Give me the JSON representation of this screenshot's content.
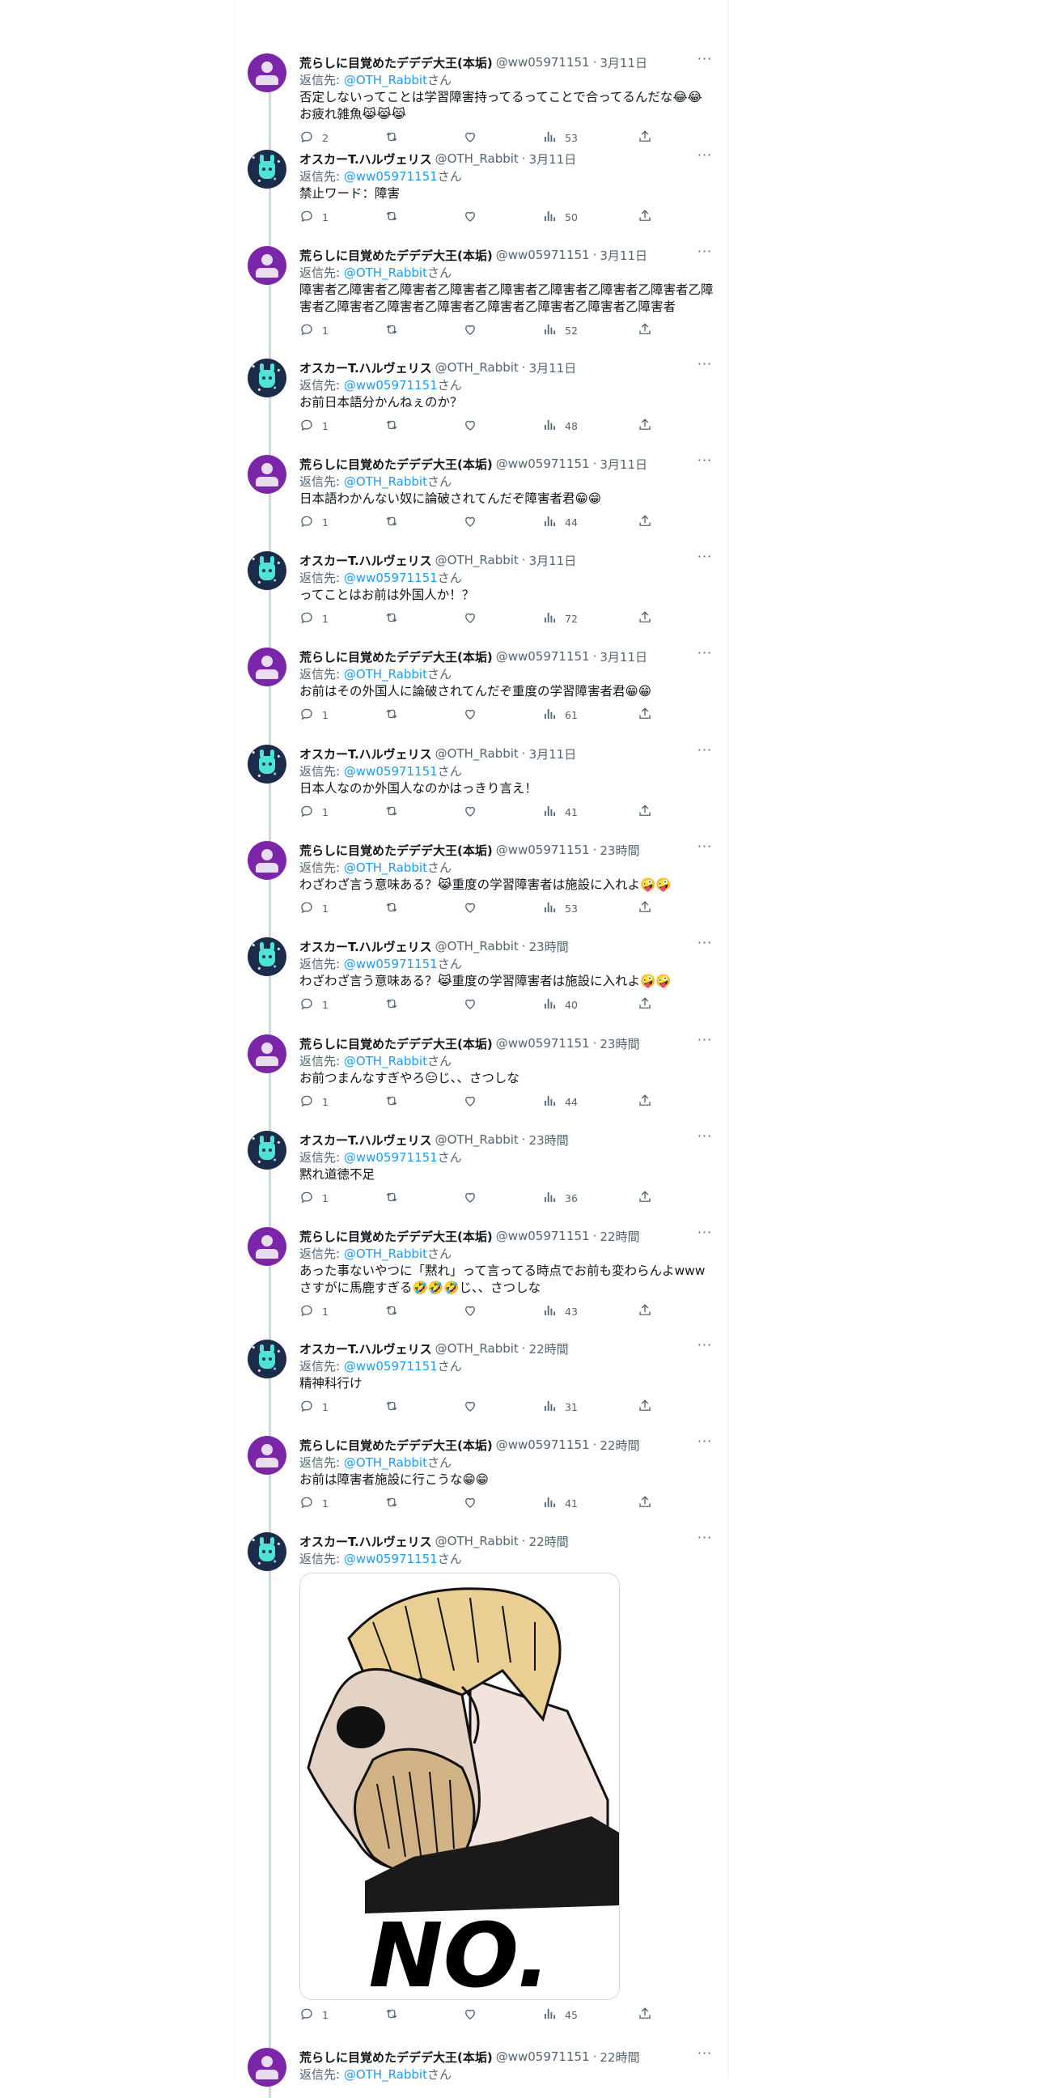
{
  "colors": {
    "link": "#1d9bf0",
    "muted": "#536471",
    "text": "#0f1419"
  },
  "tweets": [
    {
      "author": "荒らしに目覚めたデデデ大王(本垢)",
      "handle": "@ww05971151",
      "time": "3月11日",
      "reply_prefix": "返信先: ",
      "reply_to": "@OTH_Rabbit",
      "reply_suffix": "さん",
      "text": "否定しないってことは学習障害持ってるってことで合ってるんだな😂😂お疲れ雑魚😹😹😹",
      "replies": "2",
      "views": "53",
      "avatar": "default-avatar"
    },
    {
      "author": "オスカーT.ハルヴェリス",
      "handle": "@OTH_Rabbit",
      "time": "3月11日",
      "reply_prefix": "返信先: ",
      "reply_to": "@ww05971151",
      "reply_suffix": "さん",
      "text": "禁止ワード：障害",
      "replies": "1",
      "views": "50",
      "avatar": "rabbit-avatar"
    },
    {
      "author": "荒らしに目覚めたデデデ大王(本垢)",
      "handle": "@ww05971151",
      "time": "3月11日",
      "reply_prefix": "返信先: ",
      "reply_to": "@OTH_Rabbit",
      "reply_suffix": "さん",
      "text": "障害者乙障害者乙障害者乙障害者乙障害者乙障害者乙障害者乙障害者乙障害者乙障害者乙障害者乙障害者乙障害者乙障害者乙障害者乙障害者",
      "replies": "1",
      "views": "52",
      "avatar": "default-avatar"
    },
    {
      "author": "オスカーT.ハルヴェリス",
      "handle": "@OTH_Rabbit",
      "time": "3月11日",
      "reply_prefix": "返信先: ",
      "reply_to": "@ww05971151",
      "reply_suffix": "さん",
      "text": "お前日本語分かんねぇのか？",
      "replies": "1",
      "views": "48",
      "avatar": "rabbit-avatar"
    },
    {
      "author": "荒らしに目覚めたデデデ大王(本垢)",
      "handle": "@ww05971151",
      "time": "3月11日",
      "reply_prefix": "返信先: ",
      "reply_to": "@OTH_Rabbit",
      "reply_suffix": "さん",
      "text": "日本語わかんない奴に論破されてんだぞ障害者君😁😁",
      "replies": "1",
      "views": "44",
      "avatar": "default-avatar"
    },
    {
      "author": "オスカーT.ハルヴェリス",
      "handle": "@OTH_Rabbit",
      "time": "3月11日",
      "reply_prefix": "返信先: ",
      "reply_to": "@ww05971151",
      "reply_suffix": "さん",
      "text": "ってことはお前は外国人か！？",
      "replies": "1",
      "views": "72",
      "avatar": "rabbit-avatar"
    },
    {
      "author": "荒らしに目覚めたデデデ大王(本垢)",
      "handle": "@ww05971151",
      "time": "3月11日",
      "reply_prefix": "返信先: ",
      "reply_to": "@OTH_Rabbit",
      "reply_suffix": "さん",
      "text": "お前はその外国人に論破されてんだぞ重度の学習障害者君😁😁",
      "replies": "1",
      "views": "61",
      "avatar": "default-avatar"
    },
    {
      "author": "オスカーT.ハルヴェリス",
      "handle": "@OTH_Rabbit",
      "time": "3月11日",
      "reply_prefix": "返信先: ",
      "reply_to": "@ww05971151",
      "reply_suffix": "さん",
      "text": "日本人なのか外国人なのかはっきり言え！",
      "replies": "1",
      "views": "41",
      "avatar": "rabbit-avatar"
    },
    {
      "author": "荒らしに目覚めたデデデ大王(本垢)",
      "handle": "@ww05971151",
      "time": "23時間",
      "reply_prefix": "返信先: ",
      "reply_to": "@OTH_Rabbit",
      "reply_suffix": "さん",
      "text": "わざわざ言う意味ある？😹重度の学習障害者は施設に入れよ🤪🤪",
      "replies": "1",
      "views": "53",
      "avatar": "default-avatar"
    },
    {
      "author": "オスカーT.ハルヴェリス",
      "handle": "@OTH_Rabbit",
      "time": "23時間",
      "reply_prefix": "返信先: ",
      "reply_to": "@ww05971151",
      "reply_suffix": "さん",
      "text": "わざわざ言う意味ある？😹重度の学習障害者は施設に入れよ🤪🤪",
      "replies": "1",
      "views": "40",
      "avatar": "rabbit-avatar"
    },
    {
      "author": "荒らしに目覚めたデデデ大王(本垢)",
      "handle": "@ww05971151",
      "time": "23時間",
      "reply_prefix": "返信先: ",
      "reply_to": "@OTH_Rabbit",
      "reply_suffix": "さん",
      "text": "お前つまんなすぎやろ😑じ、、さつしな",
      "replies": "1",
      "views": "44",
      "avatar": "default-avatar"
    },
    {
      "author": "オスカーT.ハルヴェリス",
      "handle": "@OTH_Rabbit",
      "time": "23時間",
      "reply_prefix": "返信先: ",
      "reply_to": "@ww05971151",
      "reply_suffix": "さん",
      "text": "黙れ道徳不足",
      "replies": "1",
      "views": "36",
      "avatar": "rabbit-avatar"
    },
    {
      "author": "荒らしに目覚めたデデデ大王(本垢)",
      "handle": "@ww05971151",
      "time": "22時間",
      "reply_prefix": "返信先: ",
      "reply_to": "@OTH_Rabbit",
      "reply_suffix": "さん",
      "text": "あった事ないやつに「黙れ」って言ってる時点でお前も変わらんよwwwさすがに馬鹿すぎる🤣🤣🤣じ、、さつしな",
      "replies": "1",
      "views": "43",
      "avatar": "default-avatar"
    },
    {
      "author": "オスカーT.ハルヴェリス",
      "handle": "@OTH_Rabbit",
      "time": "22時間",
      "reply_prefix": "返信先: ",
      "reply_to": "@ww05971151",
      "reply_suffix": "さん",
      "text": "精神科行け",
      "replies": "1",
      "views": "31",
      "avatar": "rabbit-avatar"
    },
    {
      "author": "荒らしに目覚めたデデデ大王(本垢)",
      "handle": "@ww05971151",
      "time": "22時間",
      "reply_prefix": "返信先: ",
      "reply_to": "@OTH_Rabbit",
      "reply_suffix": "さん",
      "text": "お前は障害者施設に行こうな😁😁",
      "replies": "1",
      "views": "41",
      "avatar": "default-avatar"
    },
    {
      "author": "オスカーT.ハルヴェリス",
      "handle": "@OTH_Rabbit",
      "time": "22時間",
      "reply_prefix": "返信先: ",
      "reply_to": "@ww05971151",
      "reply_suffix": "さん",
      "text": "",
      "media_caption": "NO.",
      "replies": "1",
      "views": "45",
      "avatar": "rabbit-avatar"
    },
    {
      "author": "荒らしに目覚めたデデデ大王(本垢)",
      "handle": "@ww05971151",
      "time": "22時間",
      "reply_prefix": "返信先: ",
      "reply_to": "@OTH_Rabbit",
      "reply_suffix": "さん",
      "text": "",
      "replies": "",
      "views": "",
      "avatar": "default-avatar"
    }
  ]
}
